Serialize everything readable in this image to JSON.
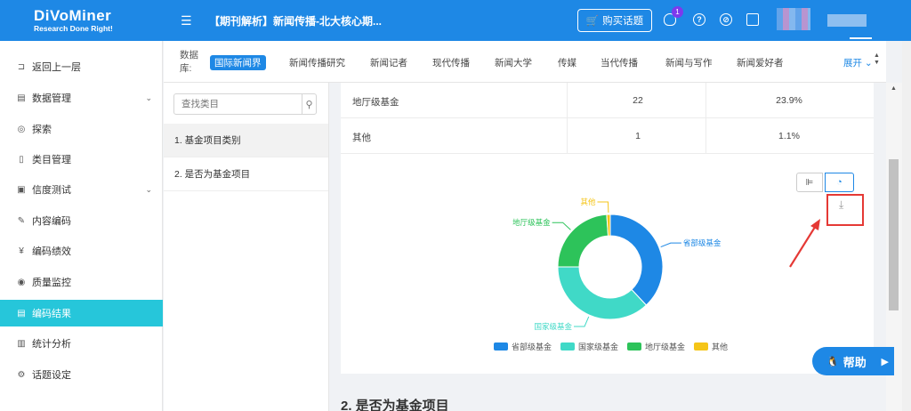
{
  "header": {
    "brand": "DiVoMiner",
    "slogan": "Research Done Right!",
    "menu_icon": "menu-fold-icon",
    "title": "【期刊解析】新闻传播-北大核心期...",
    "buy_label": "购买话题",
    "notification_count": "1"
  },
  "sidebar": {
    "items": [
      {
        "label": "返回上一层",
        "icon": "back-icon"
      },
      {
        "label": "数据管理",
        "icon": "file-icon"
      },
      {
        "label": "探索",
        "icon": "compass-icon"
      },
      {
        "label": "类目管理",
        "icon": "doc-icon"
      },
      {
        "label": "信度测试",
        "icon": "check-doc-icon"
      },
      {
        "label": "内容编码",
        "icon": "pen-icon"
      },
      {
        "label": "编码绩效",
        "icon": "coin-icon"
      },
      {
        "label": "质量监控",
        "icon": "eye-icon"
      },
      {
        "label": "编码结果",
        "icon": "list-icon"
      },
      {
        "label": "统计分析",
        "icon": "bar-chart-icon"
      },
      {
        "label": "话题设定",
        "icon": "gear-icon"
      }
    ]
  },
  "database": {
    "label": "数据库:",
    "tabs": [
      "国际新闻界",
      "新闻传播研究",
      "新闻记者",
      "现代传播",
      "新闻大学",
      "传媒",
      "当代传播",
      "新闻与写作",
      "新闻爱好者"
    ],
    "active": "国际新闻界",
    "expand_label": "展开"
  },
  "categories": {
    "search_placeholder": "查找类目",
    "items": [
      "1. 基金项目类别",
      "2. 是否为基金项目"
    ]
  },
  "table": {
    "rows": [
      {
        "name": "地厅级基金",
        "count": "22",
        "percent": "23.9%"
      },
      {
        "name": "其他",
        "count": "1",
        "percent": "1.1%"
      }
    ]
  },
  "chart_data": {
    "type": "pie",
    "donut": true,
    "labels": [
      "省部级基金",
      "国家级基金",
      "地厅级基金",
      "其他"
    ],
    "values": [
      38.0,
      37.0,
      23.9,
      1.1
    ],
    "colors": [
      "#1e88e5",
      "#40d9c7",
      "#2dc35a",
      "#f5c518"
    ],
    "legend_position": "bottom"
  },
  "section2_title": "2. 是否为基金项目",
  "help_label": "帮助"
}
